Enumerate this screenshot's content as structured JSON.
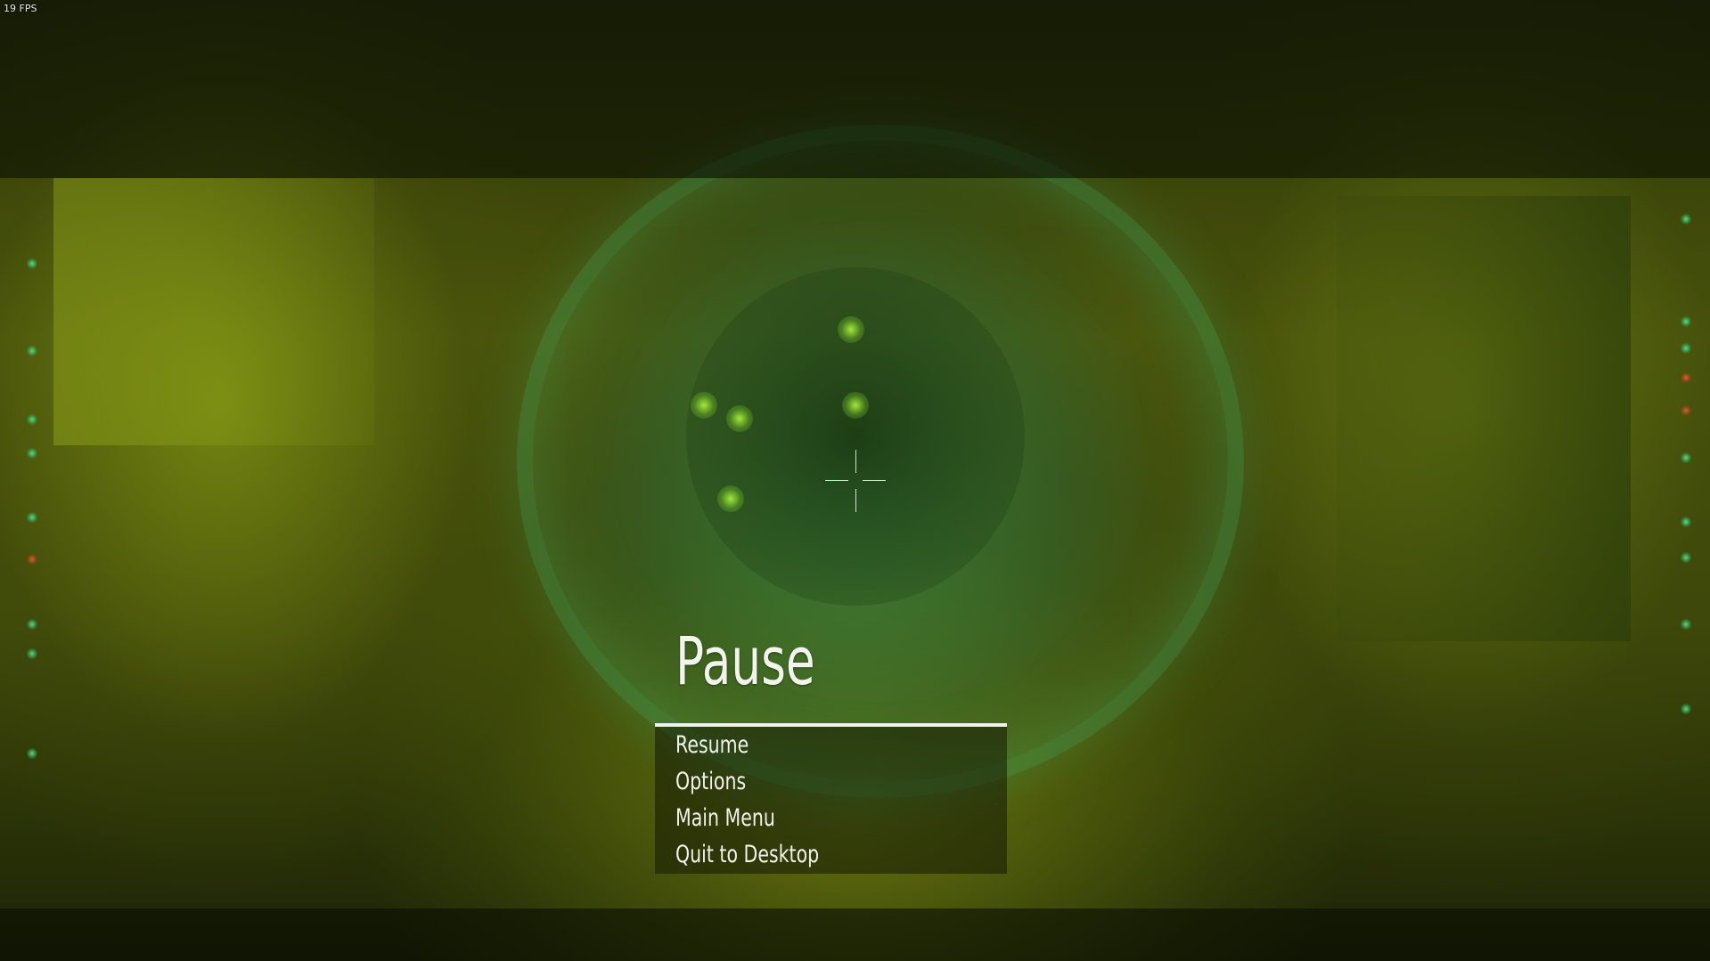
{
  "hud": {
    "fps": "19 FPS"
  },
  "pause_menu": {
    "title": "Pause",
    "items": [
      {
        "label": "Resume"
      },
      {
        "label": "Options"
      },
      {
        "label": "Main Menu"
      },
      {
        "label": "Quit to Desktop"
      }
    ]
  },
  "colors": {
    "accent_line": "#f2f2ea",
    "text": "#f1f1ea",
    "scene_tint": "#4b560c"
  },
  "icons": {
    "crosshair": "crosshair-icon"
  }
}
